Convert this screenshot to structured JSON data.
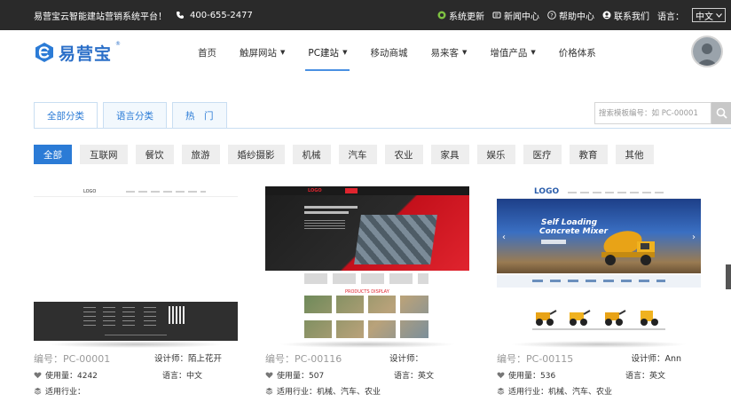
{
  "topbar": {
    "slogan": "易营宝云智能建站营销系统平台！",
    "phone": "400-655-2477",
    "links": [
      {
        "label": "系统更新",
        "icon": "refresh-icon"
      },
      {
        "label": "新闻中心",
        "icon": "news-icon"
      },
      {
        "label": "帮助中心",
        "icon": "help-icon"
      },
      {
        "label": "联系我们",
        "icon": "contact-icon"
      }
    ],
    "lang_label": "语言：",
    "lang_value": "中文"
  },
  "brand": {
    "name": "易营宝",
    "reg": "®"
  },
  "nav": [
    {
      "label": "首页",
      "has_caret": false
    },
    {
      "label": "触屏网站",
      "has_caret": true
    },
    {
      "label": "PC建站",
      "has_caret": true,
      "active": true
    },
    {
      "label": "移动商城",
      "has_caret": false
    },
    {
      "label": "易来客",
      "has_caret": true
    },
    {
      "label": "增值产品",
      "has_caret": true
    },
    {
      "label": "价格体系",
      "has_caret": false
    }
  ],
  "category_tabs": [
    {
      "label": "全部分类",
      "active": true
    },
    {
      "label": "语言分类",
      "active": false
    },
    {
      "label": "热　门",
      "active": false
    }
  ],
  "search": {
    "placeholder": "搜索模板编号：如 PC-00001"
  },
  "industries": [
    {
      "label": "全部",
      "active": true
    },
    {
      "label": "互联网"
    },
    {
      "label": "餐饮"
    },
    {
      "label": "旅游"
    },
    {
      "label": "婚纱摄影"
    },
    {
      "label": "机械"
    },
    {
      "label": "汽车"
    },
    {
      "label": "农业"
    },
    {
      "label": "家具"
    },
    {
      "label": "娱乐"
    },
    {
      "label": "医疗"
    },
    {
      "label": "教育"
    },
    {
      "label": "其他"
    }
  ],
  "templates": [
    {
      "code": "编号：PC-00001",
      "designer": "设计师：陌上花开",
      "usage": "使用量：4242",
      "language": "语言：中文",
      "industry": "适用行业：",
      "thumb_text": {
        "logo": "LOGO"
      }
    },
    {
      "code": "编号：PC-00116",
      "designer": "设计师：",
      "usage": "使用量：507",
      "language": "语言：英文",
      "industry": "适用行业：机械、汽车、农业",
      "thumb_text": {
        "logo": "LOGO",
        "section": "PRODUCTS DISPLAY"
      }
    },
    {
      "code": "编号：PC-00115",
      "designer": "设计师：Ann",
      "usage": "使用量：536",
      "language": "语言：英文",
      "industry": "适用行业：机械、汽车、农业",
      "thumb_text": {
        "logo": "LOGO",
        "hero_line1": "Self Loading",
        "hero_line2": "Concrete Mixer"
      }
    }
  ],
  "colors": {
    "accent": "#2b7bd6",
    "topbar": "#2a2a2a",
    "chip_bg": "#eeeeee",
    "brand": "#2b6fc8"
  }
}
